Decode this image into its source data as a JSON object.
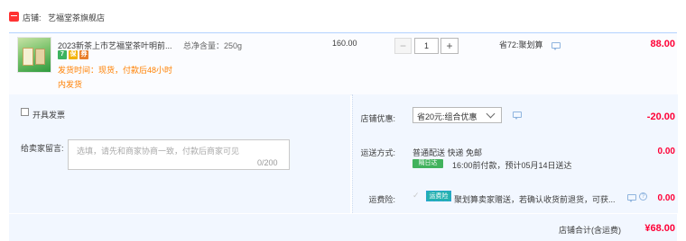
{
  "shop": {
    "label": "店铺:",
    "name": "艺福堂茶旗舰店"
  },
  "item": {
    "title": "2023新茶上市艺福堂茶叶明前...",
    "spec": "总净含量：250g",
    "badges": [
      "7",
      "保",
      "券"
    ],
    "ship_note_line1": "发货时间：现货，付款后48小时",
    "ship_note_line2": "内发货",
    "unit_price": "160.00",
    "quantity": "1",
    "saving": "省72:聚划算",
    "total": "88.00"
  },
  "options": {
    "invoice_label": "开具发票",
    "message_label": "给卖家留言:",
    "message_placeholder": "选填，请先和商家协商一致，付款后商家可见",
    "message_counter": "0/200",
    "coupon_label": "店铺优惠:",
    "coupon_value": "省20元:组合优惠",
    "coupon_amount": "-20.00",
    "shipping_label": "运送方式:",
    "shipping_method": "普通配送 快递 免邮",
    "shipping_badge": "隔日达",
    "shipping_promise": "16:00前付款，预计05月14日送达",
    "shipping_amount": "0.00",
    "insurance_label": "运费险:",
    "insurance_badge": "运费险",
    "insurance_desc": "聚划算卖家赠送，若确认收货前退货，可获...",
    "insurance_amount": "0.00"
  },
  "footer": {
    "total_label": "店铺合计(含运费)",
    "total_amount": "¥68.00"
  },
  "colors": {
    "price": "#ff0036",
    "panel": "#f2f7ff",
    "accent": "#b2d1ff"
  }
}
